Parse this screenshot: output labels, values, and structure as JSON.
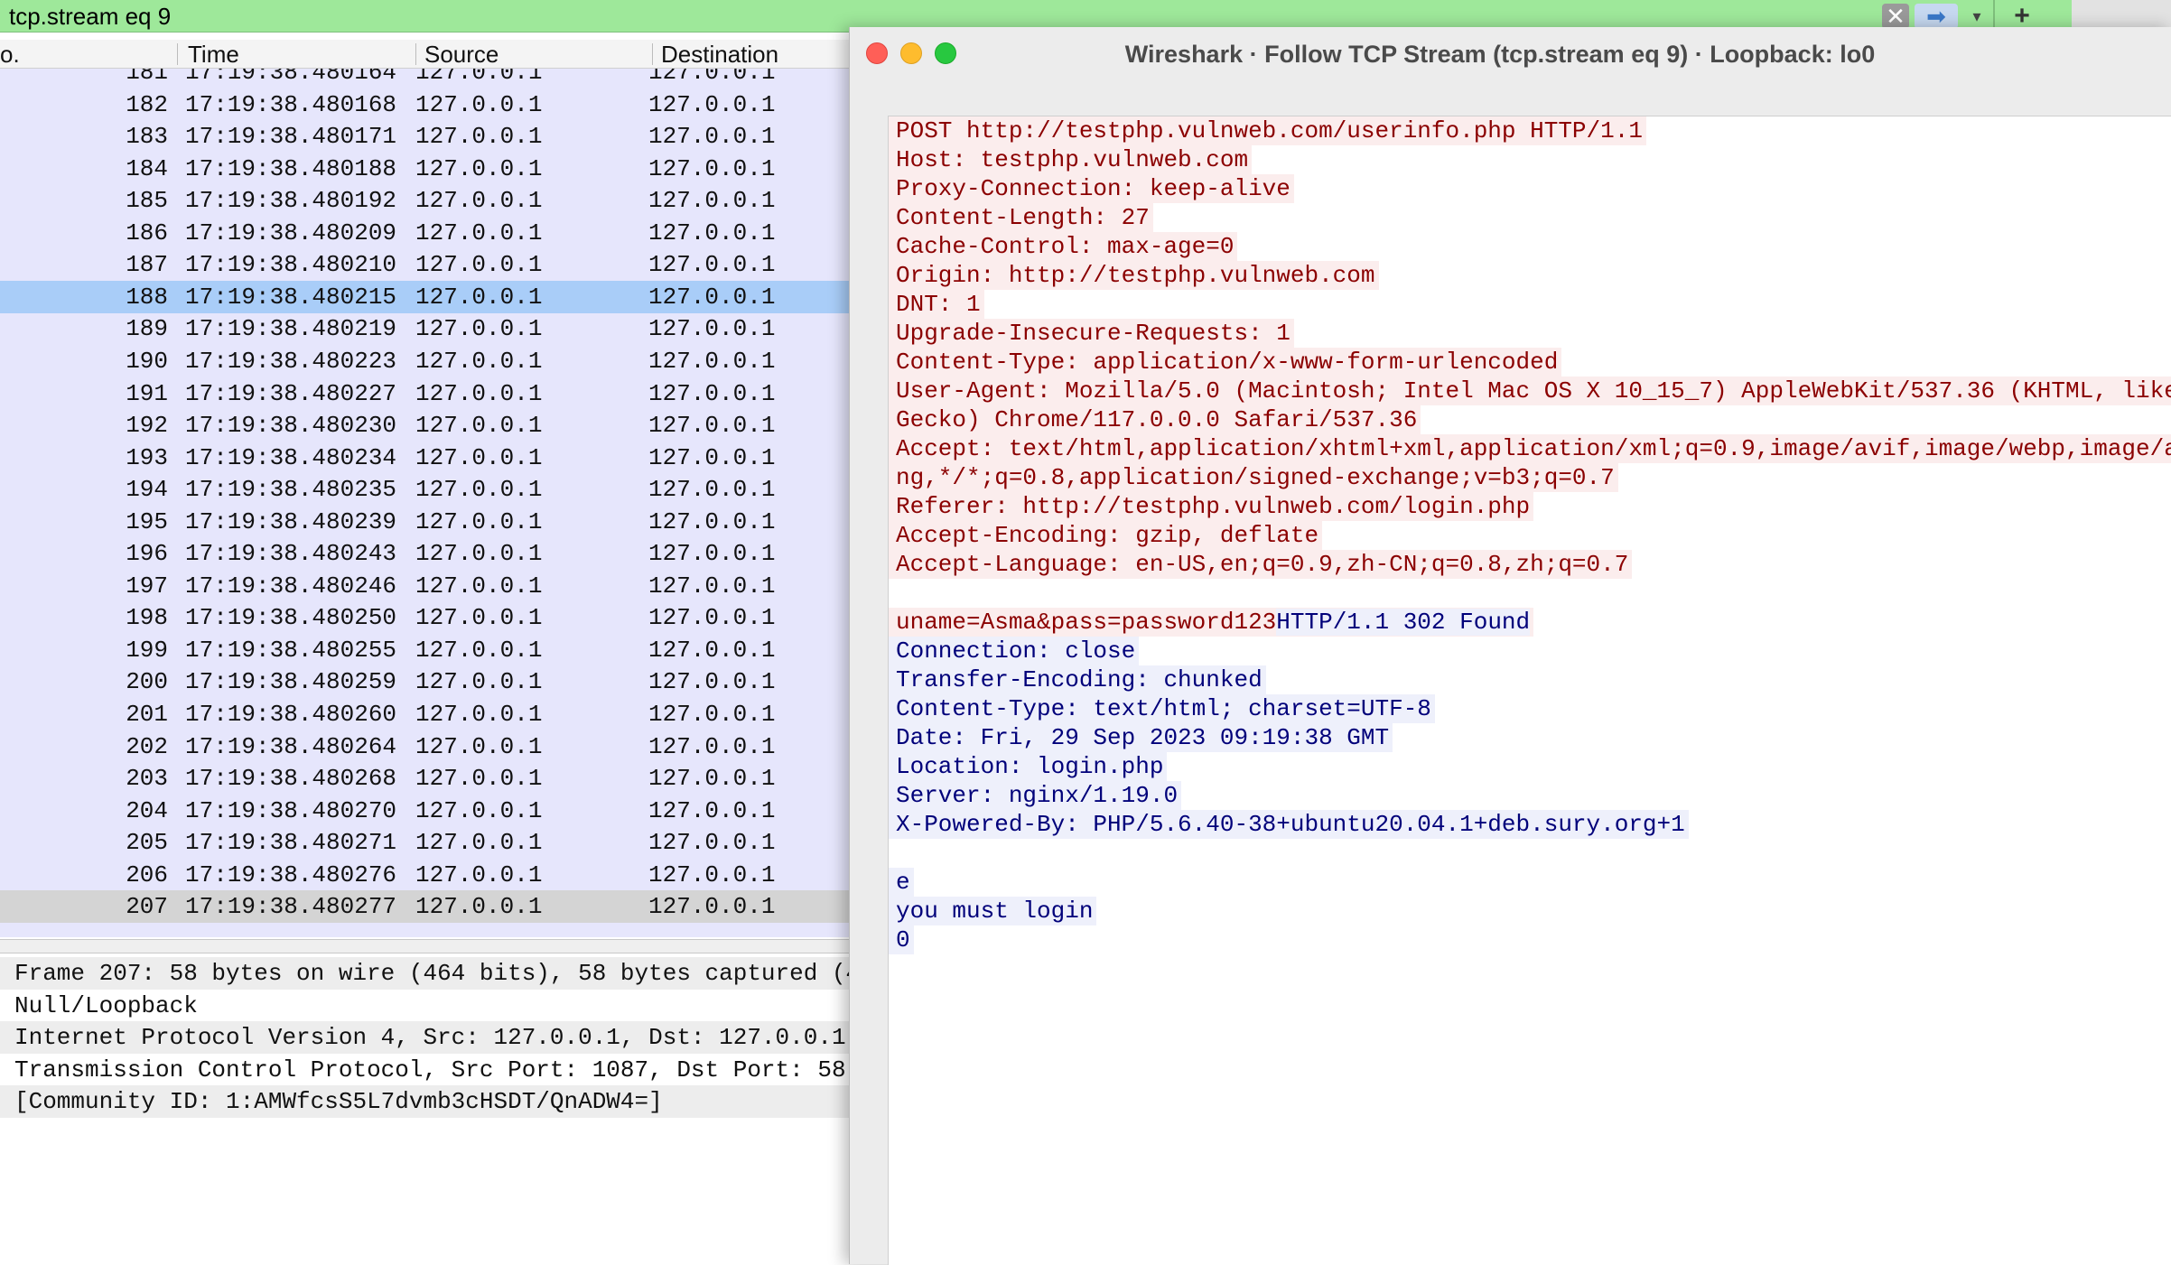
{
  "filter": {
    "value": "tcp.stream eq 9",
    "clear_icon": "clear-x-icon",
    "apply_icon": "arrow-right-icon",
    "history_icon": "chevron-down-icon",
    "add_icon": "plus-icon"
  },
  "packet_list": {
    "columns": [
      "o.",
      "Time",
      "Source",
      "Destination"
    ],
    "rows": [
      {
        "no": "181",
        "time": "17:19:38.480164",
        "src": "127.0.0.1",
        "dst": "127.0.0.1"
      },
      {
        "no": "182",
        "time": "17:19:38.480168",
        "src": "127.0.0.1",
        "dst": "127.0.0.1"
      },
      {
        "no": "183",
        "time": "17:19:38.480171",
        "src": "127.0.0.1",
        "dst": "127.0.0.1"
      },
      {
        "no": "184",
        "time": "17:19:38.480188",
        "src": "127.0.0.1",
        "dst": "127.0.0.1"
      },
      {
        "no": "185",
        "time": "17:19:38.480192",
        "src": "127.0.0.1",
        "dst": "127.0.0.1"
      },
      {
        "no": "186",
        "time": "17:19:38.480209",
        "src": "127.0.0.1",
        "dst": "127.0.0.1"
      },
      {
        "no": "187",
        "time": "17:19:38.480210",
        "src": "127.0.0.1",
        "dst": "127.0.0.1"
      },
      {
        "no": "188",
        "time": "17:19:38.480215",
        "src": "127.0.0.1",
        "dst": "127.0.0.1"
      },
      {
        "no": "189",
        "time": "17:19:38.480219",
        "src": "127.0.0.1",
        "dst": "127.0.0.1"
      },
      {
        "no": "190",
        "time": "17:19:38.480223",
        "src": "127.0.0.1",
        "dst": "127.0.0.1"
      },
      {
        "no": "191",
        "time": "17:19:38.480227",
        "src": "127.0.0.1",
        "dst": "127.0.0.1"
      },
      {
        "no": "192",
        "time": "17:19:38.480230",
        "src": "127.0.0.1",
        "dst": "127.0.0.1"
      },
      {
        "no": "193",
        "time": "17:19:38.480234",
        "src": "127.0.0.1",
        "dst": "127.0.0.1"
      },
      {
        "no": "194",
        "time": "17:19:38.480235",
        "src": "127.0.0.1",
        "dst": "127.0.0.1"
      },
      {
        "no": "195",
        "time": "17:19:38.480239",
        "src": "127.0.0.1",
        "dst": "127.0.0.1"
      },
      {
        "no": "196",
        "time": "17:19:38.480243",
        "src": "127.0.0.1",
        "dst": "127.0.0.1"
      },
      {
        "no": "197",
        "time": "17:19:38.480246",
        "src": "127.0.0.1",
        "dst": "127.0.0.1"
      },
      {
        "no": "198",
        "time": "17:19:38.480250",
        "src": "127.0.0.1",
        "dst": "127.0.0.1"
      },
      {
        "no": "199",
        "time": "17:19:38.480255",
        "src": "127.0.0.1",
        "dst": "127.0.0.1"
      },
      {
        "no": "200",
        "time": "17:19:38.480259",
        "src": "127.0.0.1",
        "dst": "127.0.0.1"
      },
      {
        "no": "201",
        "time": "17:19:38.480260",
        "src": "127.0.0.1",
        "dst": "127.0.0.1"
      },
      {
        "no": "202",
        "time": "17:19:38.480264",
        "src": "127.0.0.1",
        "dst": "127.0.0.1"
      },
      {
        "no": "203",
        "time": "17:19:38.480268",
        "src": "127.0.0.1",
        "dst": "127.0.0.1"
      },
      {
        "no": "204",
        "time": "17:19:38.480270",
        "src": "127.0.0.1",
        "dst": "127.0.0.1"
      },
      {
        "no": "205",
        "time": "17:19:38.480271",
        "src": "127.0.0.1",
        "dst": "127.0.0.1"
      },
      {
        "no": "206",
        "time": "17:19:38.480276",
        "src": "127.0.0.1",
        "dst": "127.0.0.1"
      },
      {
        "no": "207",
        "time": "17:19:38.480277",
        "src": "127.0.0.1",
        "dst": "127.0.0.1"
      }
    ],
    "selected_no": "188",
    "last_no": "207"
  },
  "details": {
    "lines": [
      "Frame 207: 58 bytes on wire (464 bits), 58 bytes captured (4",
      "Null/Loopback",
      "Internet Protocol Version 4, Src: 127.0.0.1, Dst: 127.0.0.1",
      "Transmission Control Protocol, Src Port: 1087, Dst Port: 58",
      "[Community ID: 1:AMWfcsS5L7dvmb3cHSDT/QnADW4=]"
    ]
  },
  "follow_window": {
    "title": "Wireshark · Follow TCP Stream (tcp.stream eq 9) · Loopback: lo0",
    "close_icon": "close-dot-icon",
    "minimize_icon": "minimize-dot-icon",
    "zoom_icon": "zoom-dot-icon",
    "stream_lines": [
      {
        "t": "POST http://testphp.vulnweb.com/userinfo.php HTTP/1.1",
        "k": "client"
      },
      {
        "t": "Host: testphp.vulnweb.com",
        "k": "client"
      },
      {
        "t": "Proxy-Connection: keep-alive",
        "k": "client"
      },
      {
        "t": "Content-Length: 27",
        "k": "client"
      },
      {
        "t": "Cache-Control: max-age=0",
        "k": "client"
      },
      {
        "t": "Origin: http://testphp.vulnweb.com",
        "k": "client"
      },
      {
        "t": "DNT: 1",
        "k": "client"
      },
      {
        "t": "Upgrade-Insecure-Requests: 1",
        "k": "client"
      },
      {
        "t": "Content-Type: application/x-www-form-urlencoded",
        "k": "client"
      },
      {
        "t": "User-Agent: Mozilla/5.0 (Macintosh; Intel Mac OS X 10_15_7) AppleWebKit/537.36 (KHTML, like",
        "k": "client"
      },
      {
        "t": "Gecko) Chrome/117.0.0.0 Safari/537.36",
        "k": "client"
      },
      {
        "t": "Accept: text/html,application/xhtml+xml,application/xml;q=0.9,image/avif,image/webp,image/a",
        "k": "client"
      },
      {
        "t": "ng,*/*;q=0.8,application/signed-exchange;v=b3;q=0.7",
        "k": "client"
      },
      {
        "t": "Referer: http://testphp.vulnweb.com/login.php",
        "k": "client"
      },
      {
        "t": "Accept-Encoding: gzip, deflate",
        "k": "client"
      },
      {
        "t": "Accept-Language: en-US,en;q=0.9,zh-CN;q=0.8,zh;q=0.7",
        "k": "client"
      },
      {
        "t": "",
        "k": "blank"
      },
      {
        "t": "uname=Asma&pass=password123",
        "t2": "HTTP/1.1 302 Found",
        "k": "mixed"
      },
      {
        "t": "Connection: close",
        "k": "server"
      },
      {
        "t": "Transfer-Encoding: chunked",
        "k": "server"
      },
      {
        "t": "Content-Type: text/html; charset=UTF-8",
        "k": "server"
      },
      {
        "t": "Date: Fri, 29 Sep 2023 09:19:38 GMT",
        "k": "server"
      },
      {
        "t": "Location: login.php",
        "k": "server"
      },
      {
        "t": "Server: nginx/1.19.0",
        "k": "server"
      },
      {
        "t": "X-Powered-By: PHP/5.6.40-38+ubuntu20.04.1+deb.sury.org+1",
        "k": "server"
      },
      {
        "t": "",
        "k": "blank"
      },
      {
        "t": "e",
        "k": "server"
      },
      {
        "t": "you must login",
        "k": "server"
      },
      {
        "t": "0",
        "k": "server"
      }
    ]
  },
  "colors": {
    "filter_valid_bg": "#9ee89a",
    "packet_row_bg": "#e6e6fc",
    "packet_selected_bg": "#a9cdf8",
    "client_text": "#8b0000",
    "client_bg": "#fbeded",
    "server_text": "#00007a",
    "server_bg": "#eef0fb"
  }
}
